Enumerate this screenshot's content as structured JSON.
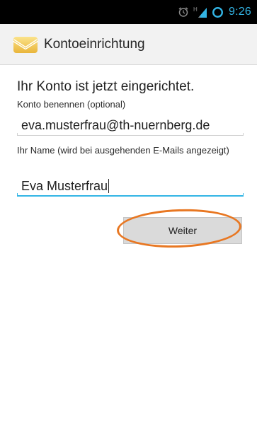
{
  "status_bar": {
    "time": "9:26",
    "icons": [
      "alarm-icon",
      "signal-icon",
      "sync-icon"
    ],
    "network_type": "H"
  },
  "action_bar": {
    "title": "Kontoeinrichtung",
    "icon": "email-app-icon"
  },
  "form": {
    "heading": "Ihr Konto ist jetzt eingerichtet.",
    "account_name_label": "Konto benennen (optional)",
    "account_name_value": "eva.musterfrau@th-nuernberg.de",
    "your_name_label": "Ihr Name (wird bei ausgehenden E-Mails angezeigt)",
    "your_name_value": "Eva Musterfrau"
  },
  "buttons": {
    "next_label": "Weiter"
  },
  "colors": {
    "accent": "#33b5e5",
    "highlight": "#e87722",
    "status_bar_bg": "#000000",
    "action_bar_bg": "#f2f2f2"
  }
}
